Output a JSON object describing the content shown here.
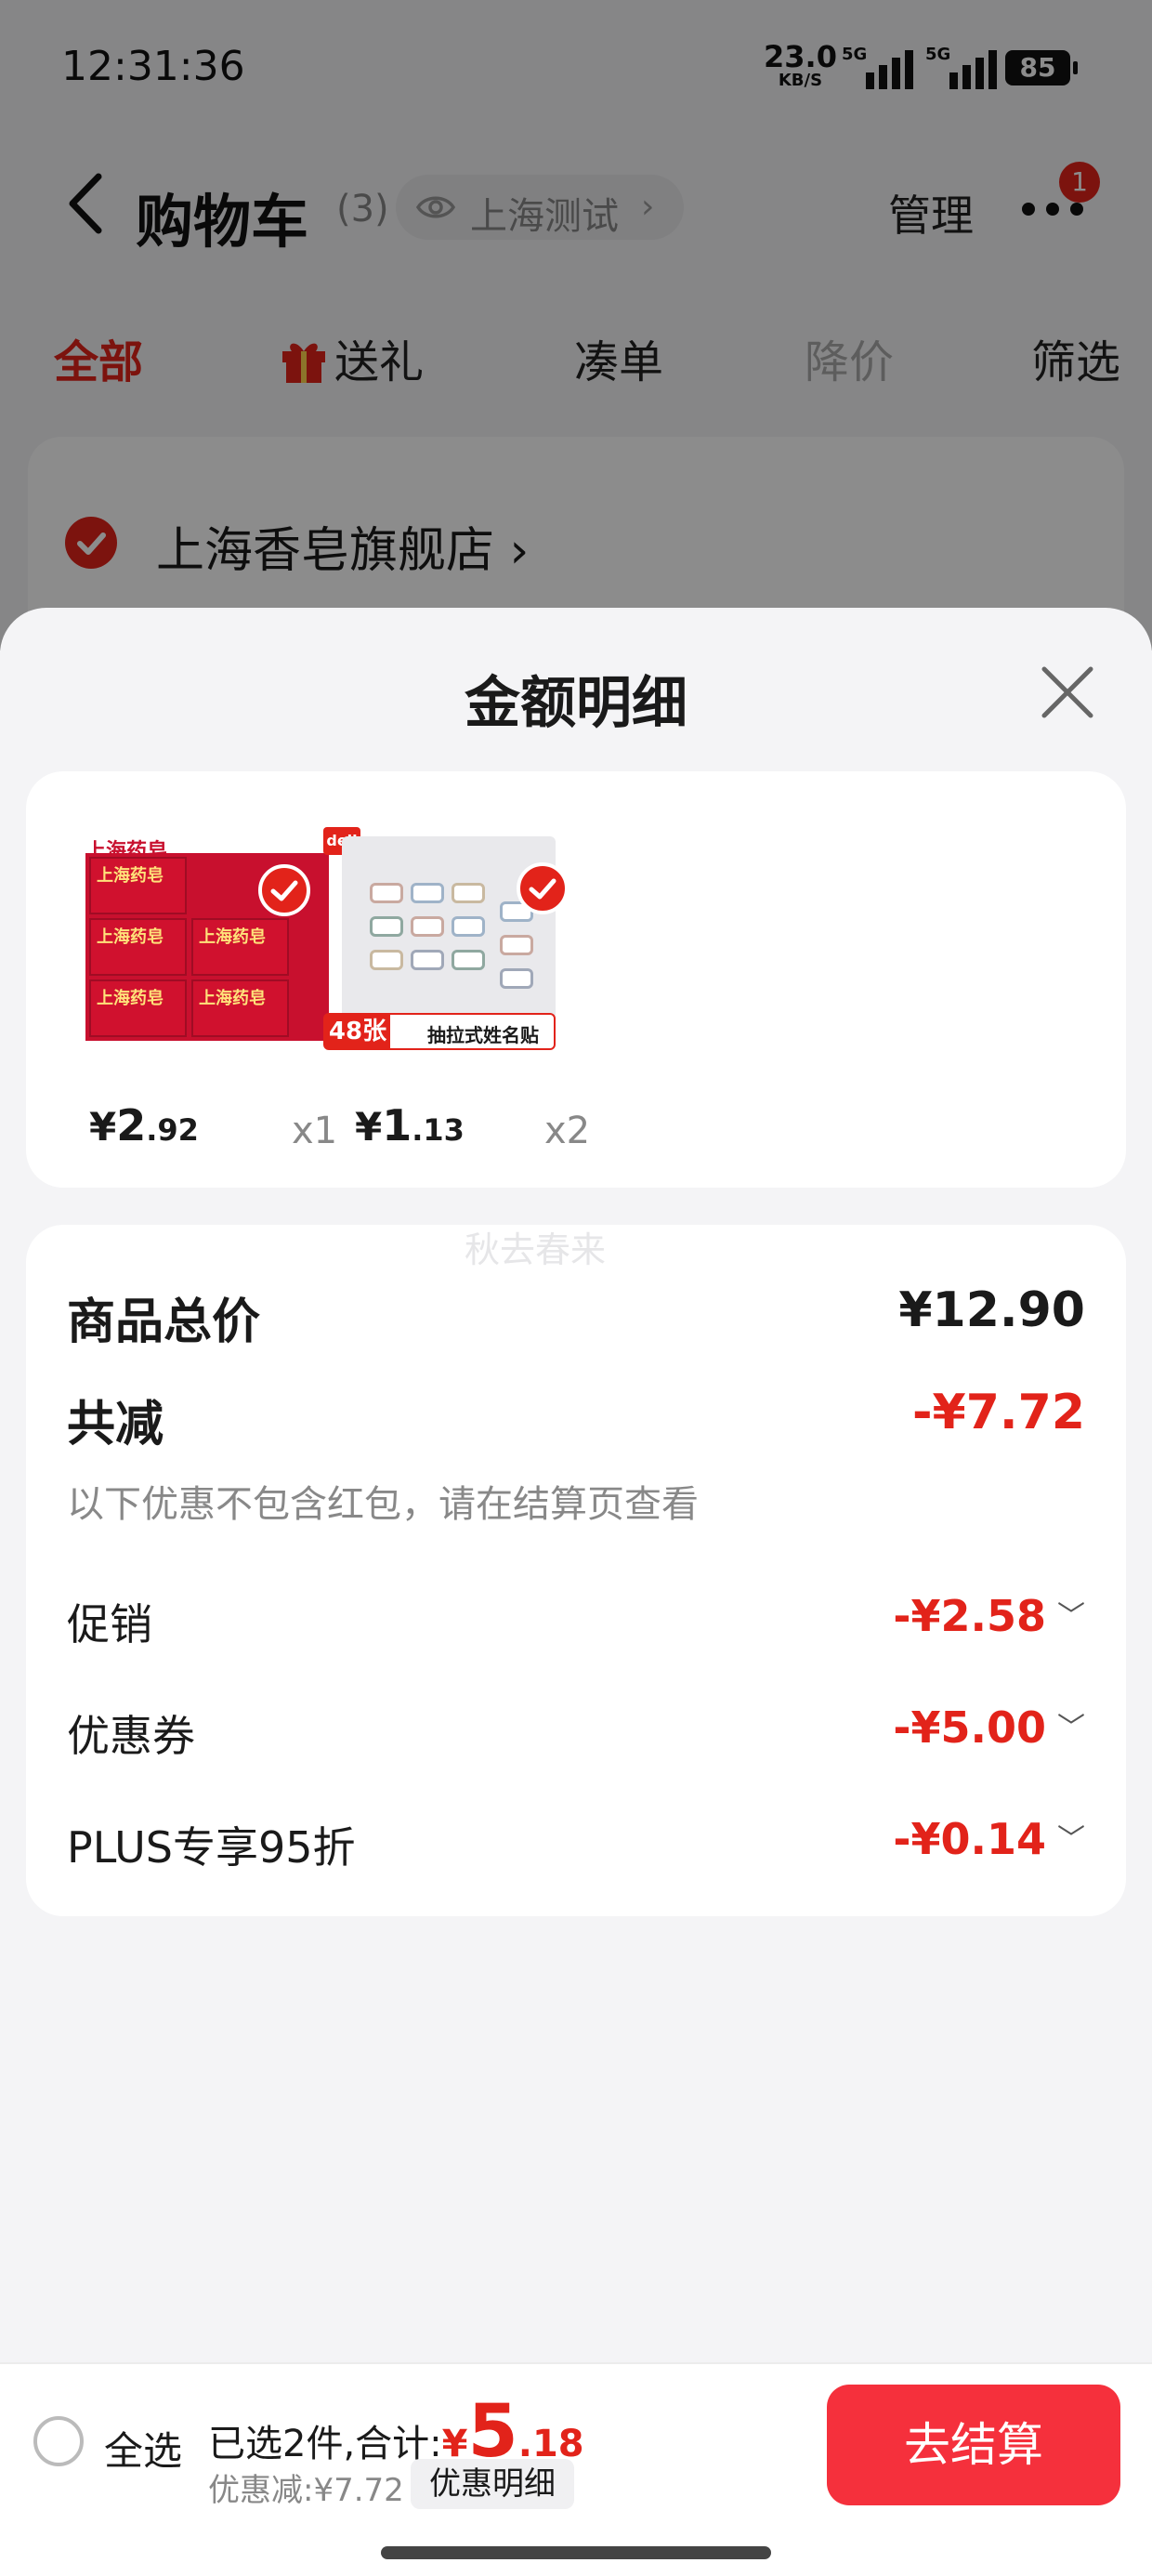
{
  "status_bar": {
    "time": "12:31:36",
    "net_speed": "23.0",
    "net_unit": "KB/S",
    "signal_label": "5G",
    "battery": "85"
  },
  "nav": {
    "title": "购物车",
    "count": "(3)",
    "location": "上海测试",
    "location_arrow": "›",
    "manage": "管理",
    "badge": "1"
  },
  "tabs": [
    {
      "label": "全部",
      "state": "active"
    },
    {
      "label": "送礼",
      "state": "normal"
    },
    {
      "label": "凑单",
      "state": "normal"
    },
    {
      "label": "降价",
      "state": "muted"
    },
    {
      "label": "筛选",
      "state": "normal"
    }
  ],
  "store": {
    "name": "上海香皂旗舰店",
    "arrow": "›"
  },
  "sheet": {
    "title": "金额明细"
  },
  "goods": [
    {
      "price_symbol": "¥",
      "price_int": "2",
      "price_dec": ".92",
      "qty": "x1",
      "image_brand": "上海药皂",
      "image_cell_text": "上海药皂"
    },
    {
      "price_symbol": "¥",
      "price_int": "1",
      "price_dec": ".13",
      "qty": "x2",
      "image_count": "48张",
      "image_caption": "抽拉式姓名贴",
      "image_brand": "deli"
    }
  ],
  "watermark": "秋去春来",
  "detail": {
    "total_label": "商品总价",
    "total_value": "¥12.90",
    "reduce_label": "共减",
    "reduce_value": "-¥7.72",
    "note": "以下优惠不包含红包，请在结算页查看",
    "items": [
      {
        "label": "促销",
        "value": "-¥2.58"
      },
      {
        "label": "优惠券",
        "value": "-¥5.00"
      },
      {
        "label": "PLUS专享95折",
        "value": "-¥0.14"
      }
    ],
    "chevron": "﹀"
  },
  "bottom": {
    "select_all": "全选",
    "summary_label": "已选2件,合计:",
    "sum_symbol": "¥",
    "sum_int": "5",
    "sum_dec": ".18",
    "discount_text": "优惠减:¥7.72",
    "detail_chip": "优惠明细",
    "checkout": "去结算"
  },
  "colors": {
    "accent": "#e2231a",
    "checkout": "#f5303c",
    "mask": "rgba(0,0,0,0.45)"
  }
}
